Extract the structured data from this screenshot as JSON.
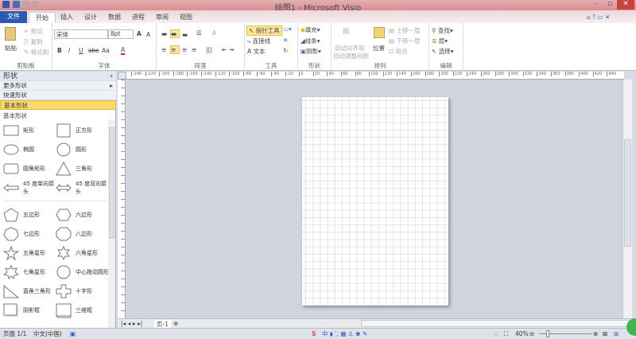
{
  "app": {
    "title": "绘图1 - Microsoft Visio"
  },
  "tabs": [
    {
      "label": "文件"
    },
    {
      "label": "开始"
    },
    {
      "label": "插入"
    },
    {
      "label": "设计"
    },
    {
      "label": "数据"
    },
    {
      "label": "进程"
    },
    {
      "label": "审阅"
    },
    {
      "label": "视图"
    }
  ],
  "ribbon": {
    "clipboard": {
      "label": "剪贴板",
      "paste": "粘贴",
      "cut": "剪切",
      "copy": "复制",
      "format_painter": "格式刷"
    },
    "font": {
      "label": "字体",
      "font_name": "宋体",
      "font_size": "8pt",
      "bold": "B",
      "italic": "I",
      "underline": "U",
      "strike": "abc",
      "case": "Aa",
      "color": "A",
      "grow": "A",
      "shrink": "A"
    },
    "paragraph": {
      "label": "段落"
    },
    "tools": {
      "label": "工具",
      "pointer": "指针工具",
      "connector": "连接线",
      "text": "文本"
    },
    "shape": {
      "label": "形状",
      "fill": "填充",
      "line": "线条",
      "shadow": "阴影"
    },
    "arrange": {
      "label": "排列",
      "auto_align": "自动对齐和",
      "auto_space": "自动调整间距",
      "position": "位置",
      "bring_forward": "上移一层",
      "send_backward": "下移一层",
      "group": "组合"
    },
    "editing": {
      "label": "编辑",
      "find": "查找",
      "layers": "层",
      "select": "选择"
    }
  },
  "shapes_panel": {
    "title": "形状",
    "more": "更多形状",
    "quick": "快速形状",
    "basic": "基本形状",
    "stencil_title": "基本形状",
    "items": [
      {
        "label": "矩形",
        "icon": "rect"
      },
      {
        "label": "正方形",
        "icon": "square"
      },
      {
        "label": "椭圆",
        "icon": "ellipse"
      },
      {
        "label": "圆形",
        "icon": "circle"
      },
      {
        "label": "圆角矩形",
        "icon": "rounded-rect"
      },
      {
        "label": "三角形",
        "icon": "triangle"
      },
      {
        "label": "45 度单向箭头",
        "icon": "arrow-single"
      },
      {
        "label": "45 度双向箭头",
        "icon": "arrow-double"
      },
      {
        "label": "五边形",
        "icon": "pentagon"
      },
      {
        "label": "六边形",
        "icon": "hexagon"
      },
      {
        "label": "七边形",
        "icon": "heptagon"
      },
      {
        "label": "八边形",
        "icon": "octagon"
      },
      {
        "label": "五角星形",
        "icon": "star5"
      },
      {
        "label": "六角星形",
        "icon": "star6"
      },
      {
        "label": "七角星形",
        "icon": "star7"
      },
      {
        "label": "中心拖动圆形",
        "icon": "circle"
      },
      {
        "label": "直角三角形",
        "icon": "right-triangle"
      },
      {
        "label": "十字形",
        "icon": "cross"
      },
      {
        "label": "阴影框",
        "icon": "shadow-box"
      },
      {
        "label": "三维框",
        "icon": "3d-box"
      }
    ]
  },
  "ruler_top": [
    "-240",
    "-220",
    "-200",
    "-180",
    "-160",
    "-140",
    "-120",
    "-100",
    "-80",
    "-60",
    "-40",
    "-20",
    "0",
    "20",
    "40",
    "60",
    "80",
    "100",
    "120",
    "140",
    "160",
    "180",
    "200",
    "220",
    "240",
    "260",
    "280",
    "300",
    "320",
    "340",
    "360",
    "380",
    "400",
    "420",
    "440"
  ],
  "page_tab": "页-1",
  "status": {
    "page": "页面 1/1",
    "language": "中文(中国)",
    "zoom": "40%"
  },
  "colors": {
    "accent": "#2b59b6",
    "highlight": "#fde59a",
    "canvas": "#d0d4dc"
  }
}
